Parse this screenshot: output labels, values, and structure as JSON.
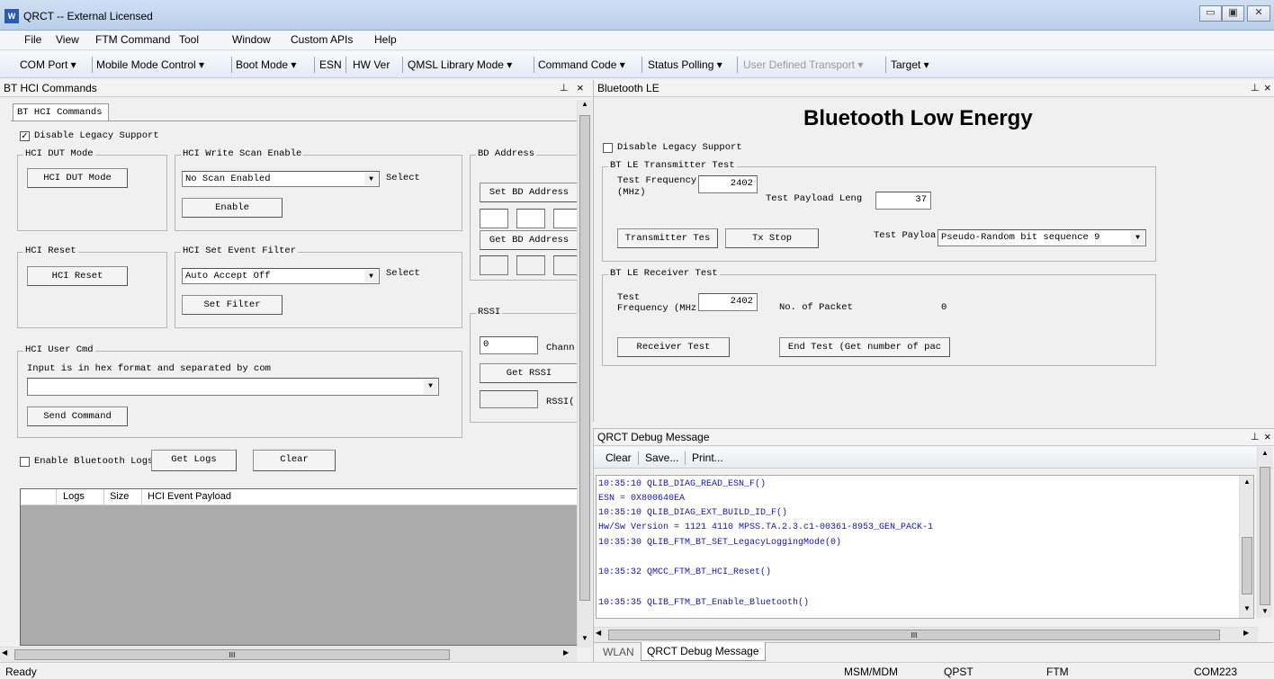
{
  "window": {
    "title": "QRCT -- External Licensed",
    "icon_letters": "W"
  },
  "menu": [
    "File",
    "View",
    "FTM Command",
    "Tool",
    "Window",
    "Custom APIs",
    "Help"
  ],
  "toolbar": [
    "COM Port ▾",
    "Mobile Mode Control ▾",
    "Boot Mode ▾",
    "ESN",
    "HW Ver",
    "QMSL Library Mode ▾",
    "Command Code ▾",
    "Status Polling ▾",
    "User Defined Transport ▾",
    "Target ▾"
  ],
  "left_pane": {
    "header": "BT HCI Commands",
    "tab": "BT HCI Commands",
    "disable_legacy": "Disable Legacy Support",
    "dut_group": "HCI DUT Mode",
    "dut_button": "HCI DUT Mode",
    "scan_group": "HCI Write Scan Enable",
    "scan_value": "No Scan Enabled",
    "select1": "Select",
    "enable_button": "Enable",
    "bd_group": "BD Address",
    "set_bd": "Set BD Address",
    "get_bd": "Get BD Address",
    "reset_group": "HCI Reset",
    "reset_button": "HCI Reset",
    "filter_group": "HCI Set Event Filter",
    "filter_value": "Auto Accept Off",
    "select2": "Select",
    "set_filter": "Set Filter",
    "rssi_group": "RSSI",
    "rssi_value": "0",
    "chann_label": "Chann",
    "get_rssi": "Get RSSI",
    "rssi_label": "RSSI(",
    "user_group": "HCI User Cmd",
    "user_hint": "Input is in hex format and separated by com",
    "send_button": "Send Command",
    "enable_logs": "Enable Bluetooth Logs",
    "get_logs": "Get Logs",
    "clear": "Clear",
    "table_headers": [
      "Logs",
      "Size",
      "HCI Event Payload"
    ],
    "hscroll_mark": "III"
  },
  "ble_pane": {
    "header": "Bluetooth LE",
    "big_title": "Bluetooth Low Energy",
    "disable_legacy": "Disable Legacy Support",
    "tx_group": "BT LE Transmitter Test",
    "tx_freq_label": "Test Frequency\n(MHz)",
    "tx_freq_value": "2402",
    "payload_len_label": "Test Payload Leng",
    "payload_len_value": "37",
    "tx_test_button": "Transmitter Tes",
    "tx_stop_button": "Tx Stop",
    "payload_label": "Test Payloa",
    "payload_value": "Pseudo-Random bit sequence 9",
    "rx_group": "BT LE Receiver Test",
    "rx_freq_label": "Test\nFrequency (MHz",
    "rx_freq_value": "2402",
    "packets_label": "No. of Packet",
    "packets_value": "0",
    "rx_test_button": "Receiver Test",
    "end_test_button": "End Test (Get number of pac"
  },
  "debug_pane": {
    "header": "QRCT Debug Message",
    "buttons": [
      "Clear",
      "Save...",
      "Print..."
    ],
    "lines": [
      "10:35:10  QLIB_DIAG_READ_ESN_F()",
      "ESN = 0X800640EA",
      "10:35:10  QLIB_DIAG_EXT_BUILD_ID_F()",
      "Hw/Sw Version = 1121  4110  MPSS.TA.2.3.c1-00361-8953_GEN_PACK-1",
      "10:35:30  QLIB_FTM_BT_SET_LegacyLoggingMode(0)",
      "",
      "10:35:32  QMCC_FTM_BT_HCI_Reset()",
      "",
      "10:35:35  QLIB_FTM_BT_Enable_Bluetooth()"
    ],
    "hscroll_mark": "III",
    "tabs": [
      "WLAN",
      "QRCT Debug Message"
    ]
  },
  "status": {
    "left": "Ready",
    "items": [
      "MSM/MDM",
      "QPST",
      "FTM",
      "COM223"
    ]
  }
}
